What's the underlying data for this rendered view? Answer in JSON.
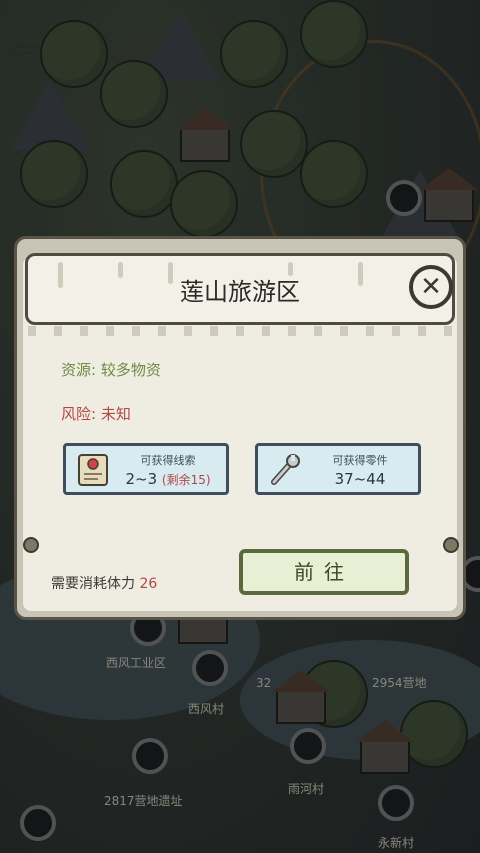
{
  "map": {
    "labels": [
      "西风工业区",
      "西风村",
      "2954营地",
      "2817营地遗址",
      "雨河村",
      "永新村",
      "32"
    ]
  },
  "dialog": {
    "title": "莲山旅游区",
    "resource": "资源: 较多物资",
    "risk": "风险: 未知",
    "cards": [
      {
        "caption": "可获得线索",
        "value": "2~3",
        "remain": "(剩余15)",
        "icon": "scroll-map-icon"
      },
      {
        "caption": "可获得零件",
        "value": "37~44",
        "icon": "wrench-icon"
      }
    ],
    "cost_label": "需要消耗体力",
    "cost_value": "26",
    "go_label": "前往"
  },
  "colors": {
    "resource": "#6e8a45",
    "risk": "#b24747",
    "card_bg": "#d7ebf0",
    "go_bg": "#e9efd5"
  }
}
